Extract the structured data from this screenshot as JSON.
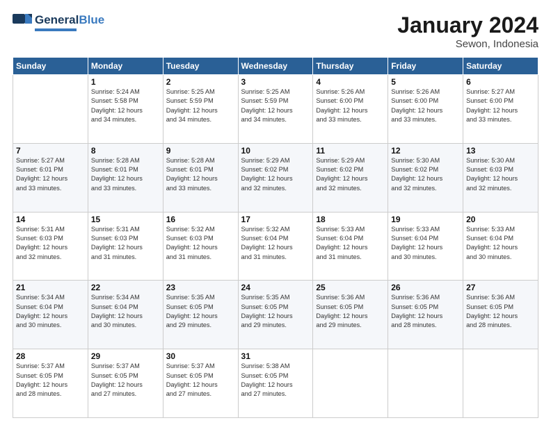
{
  "header": {
    "logo_general": "General",
    "logo_blue": "Blue",
    "title": "January 2024",
    "subtitle": "Sewon, Indonesia"
  },
  "days_of_week": [
    "Sunday",
    "Monday",
    "Tuesday",
    "Wednesday",
    "Thursday",
    "Friday",
    "Saturday"
  ],
  "weeks": [
    [
      {
        "day": "",
        "info": ""
      },
      {
        "day": "1",
        "info": "Sunrise: 5:24 AM\nSunset: 5:58 PM\nDaylight: 12 hours\nand 34 minutes."
      },
      {
        "day": "2",
        "info": "Sunrise: 5:25 AM\nSunset: 5:59 PM\nDaylight: 12 hours\nand 34 minutes."
      },
      {
        "day": "3",
        "info": "Sunrise: 5:25 AM\nSunset: 5:59 PM\nDaylight: 12 hours\nand 34 minutes."
      },
      {
        "day": "4",
        "info": "Sunrise: 5:26 AM\nSunset: 6:00 PM\nDaylight: 12 hours\nand 33 minutes."
      },
      {
        "day": "5",
        "info": "Sunrise: 5:26 AM\nSunset: 6:00 PM\nDaylight: 12 hours\nand 33 minutes."
      },
      {
        "day": "6",
        "info": "Sunrise: 5:27 AM\nSunset: 6:00 PM\nDaylight: 12 hours\nand 33 minutes."
      }
    ],
    [
      {
        "day": "7",
        "info": "Sunrise: 5:27 AM\nSunset: 6:01 PM\nDaylight: 12 hours\nand 33 minutes."
      },
      {
        "day": "8",
        "info": "Sunrise: 5:28 AM\nSunset: 6:01 PM\nDaylight: 12 hours\nand 33 minutes."
      },
      {
        "day": "9",
        "info": "Sunrise: 5:28 AM\nSunset: 6:01 PM\nDaylight: 12 hours\nand 33 minutes."
      },
      {
        "day": "10",
        "info": "Sunrise: 5:29 AM\nSunset: 6:02 PM\nDaylight: 12 hours\nand 32 minutes."
      },
      {
        "day": "11",
        "info": "Sunrise: 5:29 AM\nSunset: 6:02 PM\nDaylight: 12 hours\nand 32 minutes."
      },
      {
        "day": "12",
        "info": "Sunrise: 5:30 AM\nSunset: 6:02 PM\nDaylight: 12 hours\nand 32 minutes."
      },
      {
        "day": "13",
        "info": "Sunrise: 5:30 AM\nSunset: 6:03 PM\nDaylight: 12 hours\nand 32 minutes."
      }
    ],
    [
      {
        "day": "14",
        "info": "Sunrise: 5:31 AM\nSunset: 6:03 PM\nDaylight: 12 hours\nand 32 minutes."
      },
      {
        "day": "15",
        "info": "Sunrise: 5:31 AM\nSunset: 6:03 PM\nDaylight: 12 hours\nand 31 minutes."
      },
      {
        "day": "16",
        "info": "Sunrise: 5:32 AM\nSunset: 6:03 PM\nDaylight: 12 hours\nand 31 minutes."
      },
      {
        "day": "17",
        "info": "Sunrise: 5:32 AM\nSunset: 6:04 PM\nDaylight: 12 hours\nand 31 minutes."
      },
      {
        "day": "18",
        "info": "Sunrise: 5:33 AM\nSunset: 6:04 PM\nDaylight: 12 hours\nand 31 minutes."
      },
      {
        "day": "19",
        "info": "Sunrise: 5:33 AM\nSunset: 6:04 PM\nDaylight: 12 hours\nand 30 minutes."
      },
      {
        "day": "20",
        "info": "Sunrise: 5:33 AM\nSunset: 6:04 PM\nDaylight: 12 hours\nand 30 minutes."
      }
    ],
    [
      {
        "day": "21",
        "info": "Sunrise: 5:34 AM\nSunset: 6:04 PM\nDaylight: 12 hours\nand 30 minutes."
      },
      {
        "day": "22",
        "info": "Sunrise: 5:34 AM\nSunset: 6:04 PM\nDaylight: 12 hours\nand 30 minutes."
      },
      {
        "day": "23",
        "info": "Sunrise: 5:35 AM\nSunset: 6:05 PM\nDaylight: 12 hours\nand 29 minutes."
      },
      {
        "day": "24",
        "info": "Sunrise: 5:35 AM\nSunset: 6:05 PM\nDaylight: 12 hours\nand 29 minutes."
      },
      {
        "day": "25",
        "info": "Sunrise: 5:36 AM\nSunset: 6:05 PM\nDaylight: 12 hours\nand 29 minutes."
      },
      {
        "day": "26",
        "info": "Sunrise: 5:36 AM\nSunset: 6:05 PM\nDaylight: 12 hours\nand 28 minutes."
      },
      {
        "day": "27",
        "info": "Sunrise: 5:36 AM\nSunset: 6:05 PM\nDaylight: 12 hours\nand 28 minutes."
      }
    ],
    [
      {
        "day": "28",
        "info": "Sunrise: 5:37 AM\nSunset: 6:05 PM\nDaylight: 12 hours\nand 28 minutes."
      },
      {
        "day": "29",
        "info": "Sunrise: 5:37 AM\nSunset: 6:05 PM\nDaylight: 12 hours\nand 27 minutes."
      },
      {
        "day": "30",
        "info": "Sunrise: 5:37 AM\nSunset: 6:05 PM\nDaylight: 12 hours\nand 27 minutes."
      },
      {
        "day": "31",
        "info": "Sunrise: 5:38 AM\nSunset: 6:05 PM\nDaylight: 12 hours\nand 27 minutes."
      },
      {
        "day": "",
        "info": ""
      },
      {
        "day": "",
        "info": ""
      },
      {
        "day": "",
        "info": ""
      }
    ]
  ]
}
